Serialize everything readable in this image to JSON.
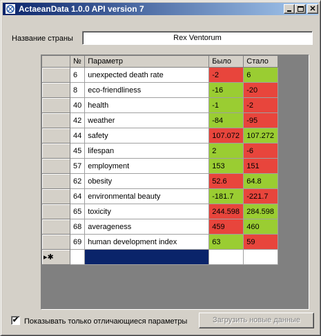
{
  "window": {
    "title": "ActaeanData 1.0.0 API version 7",
    "buttons": {
      "minimize": "_",
      "maximize": "□",
      "close": "✕"
    }
  },
  "country": {
    "label": "Название страны",
    "value": "Rex Ventorum"
  },
  "grid": {
    "columns": [
      "№",
      "Параметр",
      "Было",
      "Стало"
    ],
    "rows": [
      {
        "num": "6",
        "param": "unexpected death rate",
        "was": "-2",
        "now": "6",
        "was_status": "red",
        "now_status": "green"
      },
      {
        "num": "8",
        "param": "eco-friendliness",
        "was": "-16",
        "now": "-20",
        "was_status": "green",
        "now_status": "red"
      },
      {
        "num": "40",
        "param": "health",
        "was": "-1",
        "now": "-2",
        "was_status": "green",
        "now_status": "red"
      },
      {
        "num": "42",
        "param": "weather",
        "was": "-84",
        "now": "-95",
        "was_status": "green",
        "now_status": "red"
      },
      {
        "num": "44",
        "param": "safety",
        "was": "107.072",
        "now": "107.272",
        "was_status": "red",
        "now_status": "green"
      },
      {
        "num": "45",
        "param": "lifespan",
        "was": "2",
        "now": "-6",
        "was_status": "green",
        "now_status": "red"
      },
      {
        "num": "57",
        "param": "employment",
        "was": "153",
        "now": "151",
        "was_status": "green",
        "now_status": "red"
      },
      {
        "num": "62",
        "param": "obesity",
        "was": "52.6",
        "now": "64.8",
        "was_status": "red",
        "now_status": "green"
      },
      {
        "num": "64",
        "param": "environmental beauty",
        "was": "-181.7",
        "now": "-221.7",
        "was_status": "green",
        "now_status": "red"
      },
      {
        "num": "65",
        "param": "toxicity",
        "was": "244.598",
        "now": "284.598",
        "was_status": "red",
        "now_status": "green"
      },
      {
        "num": "68",
        "param": "averageness",
        "was": "459",
        "now": "460",
        "was_status": "red",
        "now_status": "green"
      },
      {
        "num": "69",
        "param": "human development index",
        "was": "63",
        "now": "59",
        "was_status": "green",
        "now_status": "red"
      }
    ],
    "new_row_marker": "▸✱"
  },
  "colors": {
    "green": "#9acd32",
    "red": "#e8453c",
    "selection": "#0a246a"
  },
  "footer": {
    "checkbox_checked": true,
    "checkbox_label": "Показывать только отличающиеся параметры",
    "load_button": "Загрузить новые данные"
  }
}
